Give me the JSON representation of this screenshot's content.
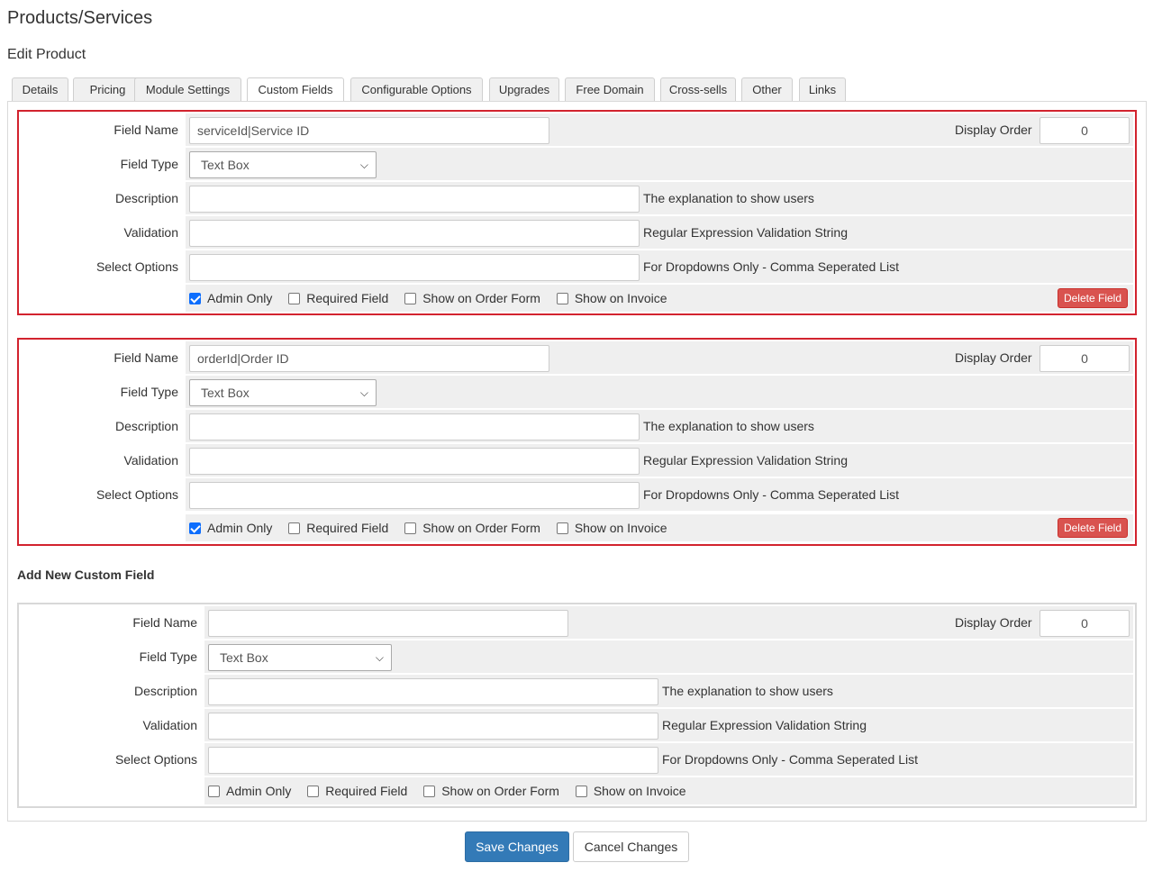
{
  "header": {
    "title": "Products/Services",
    "subtitle": "Edit Product"
  },
  "tabs": [
    {
      "label": "Details"
    },
    {
      "label": "Pricing"
    },
    {
      "label": "Module Settings"
    },
    {
      "label": "Custom Fields"
    },
    {
      "label": "Configurable Options"
    },
    {
      "label": "Upgrades"
    },
    {
      "label": "Free Domain"
    },
    {
      "label": "Cross-sells"
    },
    {
      "label": "Other"
    },
    {
      "label": "Links"
    }
  ],
  "active_tab": "Custom Fields",
  "labels": {
    "field_name": "Field Name",
    "field_type": "Field Type",
    "description": "Description",
    "validation": "Validation",
    "select_options": "Select Options",
    "display_order": "Display Order",
    "description_hint": "The explanation to show users",
    "validation_hint": "Regular Expression Validation String",
    "select_options_hint": "For Dropdowns Only - Comma Seperated List",
    "admin_only": "Admin Only",
    "required_field": "Required Field",
    "show_on_order_form": "Show on Order Form",
    "show_on_invoice": "Show on Invoice",
    "delete_field": "Delete Field"
  },
  "fields": [
    {
      "field_name": "serviceId|Service ID",
      "field_type": "Text Box",
      "display_order": "0",
      "description": "",
      "validation": "",
      "select_options": "",
      "admin_only": true,
      "required_field": false,
      "show_on_order_form": false,
      "show_on_invoice": false
    },
    {
      "field_name": "orderId|Order ID",
      "field_type": "Text Box",
      "display_order": "0",
      "description": "",
      "validation": "",
      "select_options": "",
      "admin_only": true,
      "required_field": false,
      "show_on_order_form": false,
      "show_on_invoice": false
    }
  ],
  "new_field": {
    "section_title": "Add New Custom Field",
    "field_name": "",
    "field_type": "Text Box",
    "display_order": "0",
    "admin_only": false,
    "required_field": false,
    "show_on_order_form": false,
    "show_on_invoice": false
  },
  "actions": {
    "save": "Save Changes",
    "cancel": "Cancel Changes"
  },
  "colors": {
    "highlight_border": "#d2232e",
    "delete_button": "#d9534f",
    "primary_button": "#337ab7",
    "checkbox_checked": "#0d6efd"
  }
}
